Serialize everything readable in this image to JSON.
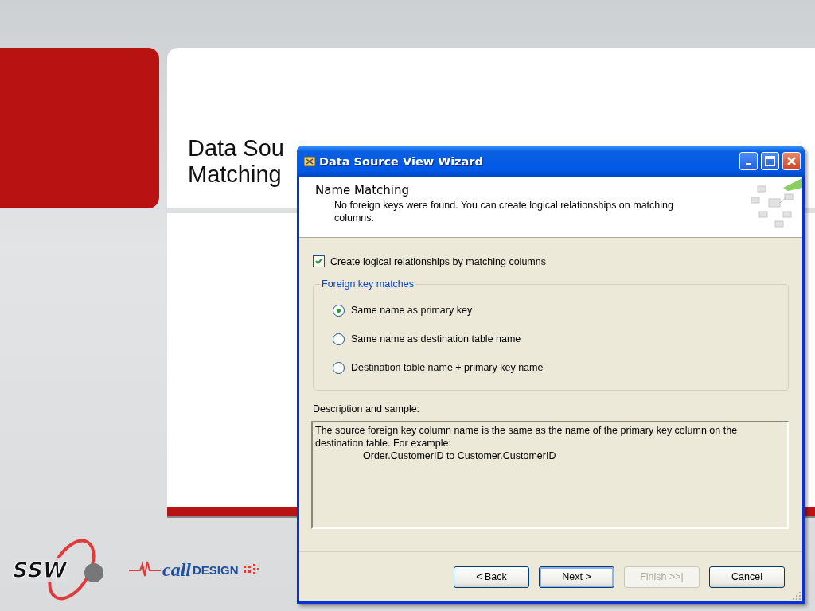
{
  "slide": {
    "title_lines": [
      "Data Sou",
      "Matching"
    ]
  },
  "logos": [
    {
      "kind": "ssw",
      "parts": [
        "SSW"
      ]
    },
    {
      "kind": "calldesign",
      "parts": [
        "call",
        "DESIGN"
      ]
    }
  ],
  "dialog": {
    "title": "Data Source View Wizard",
    "heading": "Name Matching",
    "subtitle": "No foreign keys were found. You can create logical relationships on matching columns.",
    "checkbox": {
      "label": "Create logical relationships by matching columns",
      "checked": true
    },
    "group": {
      "title": "Foreign key matches",
      "options": [
        {
          "label": "Same name as primary key",
          "selected": true
        },
        {
          "label": "Same name as destination table name",
          "selected": false
        },
        {
          "label": "Destination table name + primary key name",
          "selected": false
        }
      ]
    },
    "description_label": "Description and sample:",
    "description": [
      "The source foreign key column name is the same as the name of the primary key column on the destination table. For example:",
      "Order.CustomerID to Customer.CustomerID"
    ],
    "buttons": [
      {
        "label": "< Back",
        "disabled": false,
        "default": false
      },
      {
        "label": "Next >",
        "disabled": false,
        "default": true
      },
      {
        "label": "Finish >>|",
        "disabled": true,
        "default": false
      },
      {
        "label": "Cancel",
        "disabled": false,
        "default": false
      }
    ]
  }
}
